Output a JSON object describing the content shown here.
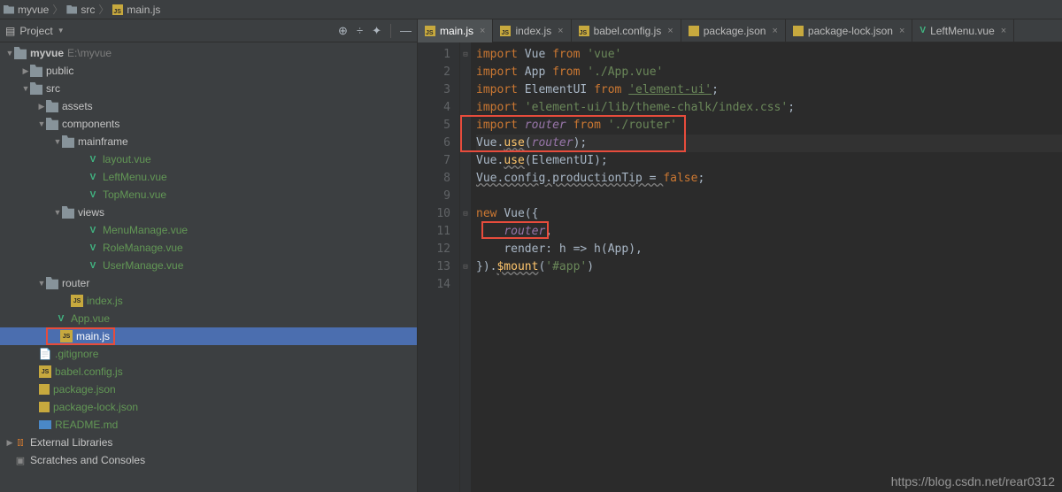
{
  "breadcrumb": {
    "root": "myvue",
    "folder": "src",
    "file": "main.js"
  },
  "project_panel": {
    "title": "Project",
    "tree": {
      "root_name": "myvue",
      "root_path": "E:\\myvue",
      "public": "public",
      "src": "src",
      "assets": "assets",
      "components": "components",
      "mainframe": "mainframe",
      "layout": "layout.vue",
      "leftmenu": "LeftMenu.vue",
      "topmenu": "TopMenu.vue",
      "views": "views",
      "menumanage": "MenuManage.vue",
      "rolemanage": "RoleManage.vue",
      "usermanage": "UserManage.vue",
      "router": "router",
      "indexjs": "index.js",
      "appvue": "App.vue",
      "mainjs": "main.js",
      "gitignore": ".gitignore",
      "babel": "babel.config.js",
      "packagejson": "package.json",
      "packagelock": "package-lock.json",
      "readme": "README.md",
      "extlib": "External Libraries",
      "scratches": "Scratches and Consoles"
    }
  },
  "tabs": [
    {
      "label": "main.js",
      "active": true,
      "icon": "js"
    },
    {
      "label": "index.js",
      "active": false,
      "icon": "js"
    },
    {
      "label": "babel.config.js",
      "active": false,
      "icon": "js"
    },
    {
      "label": "package.json",
      "active": false,
      "icon": "json"
    },
    {
      "label": "package-lock.json",
      "active": false,
      "icon": "json"
    },
    {
      "label": "LeftMenu.vue",
      "active": false,
      "icon": "vue"
    }
  ],
  "code": {
    "l1": {
      "kw": "import",
      "id": " Vue ",
      "kw2": "from ",
      "str": "'vue'"
    },
    "l2": {
      "kw": "import",
      "id": " App ",
      "kw2": "from ",
      "str": "'./App.vue'"
    },
    "l3": {
      "kw": "import",
      "id": " ElementUI ",
      "kw2": "from ",
      "str": "'element-ui'",
      "sc": ";"
    },
    "l4": {
      "kw": "import ",
      "str": "'element-ui/lib/theme-chalk/index.css'",
      "sc": ";"
    },
    "l5": {
      "kw": "import ",
      "par": "router",
      "kw2": " from ",
      "str": "'./router'"
    },
    "l6": {
      "id": "Vue.",
      "call": "use",
      "p1": "(",
      "par": "router",
      "p2": ");"
    },
    "l7": {
      "id": "Vue.",
      "call": "use",
      "p1": "(ElementUI);"
    },
    "l8": {
      "id": "Vue.config.productionTip = ",
      "bool": "false",
      "sc": ";"
    },
    "l10": {
      "kw": "new ",
      "id": "Vue({"
    },
    "l11": {
      "par": "router",
      "p": ","
    },
    "l12": {
      "id": "render: h => h(App),"
    },
    "l13": {
      "id": "}).",
      "call": "$mount",
      "p": "(",
      "str": "'#app'",
      "p2": ")"
    }
  },
  "watermark": "https://blog.csdn.net/rear0312"
}
